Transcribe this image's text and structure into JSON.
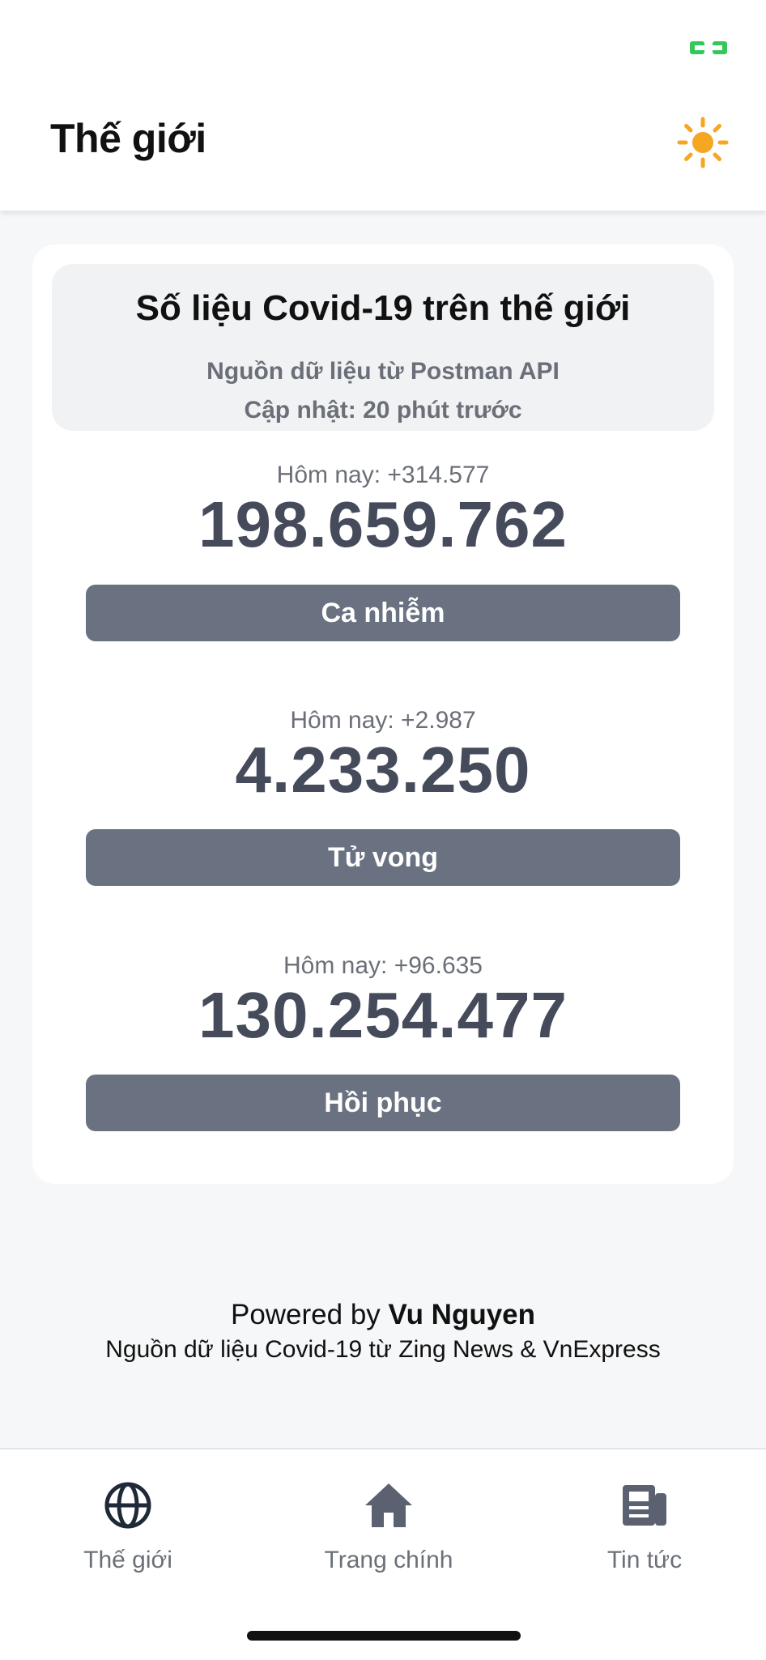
{
  "colors": {
    "accent_sun": "#f5a623",
    "stat_value": "#454b5a",
    "stat_button": "#6a7180",
    "status_green": "#34c759"
  },
  "header": {
    "title": "Thế giới",
    "theme_icon": "sun-icon"
  },
  "summary": {
    "title": "Số liệu Covid-19 trên thế giới",
    "source": "Nguồn dữ liệu từ Postman API",
    "updated": "Cập nhật: 20 phút trước"
  },
  "stats": [
    {
      "today": "Hôm nay: +314.577",
      "value": "198.659.762",
      "label": "Ca nhiễm"
    },
    {
      "today": "Hôm nay: +2.987",
      "value": "4.233.250",
      "label": "Tử vong"
    },
    {
      "today": "Hôm nay: +96.635",
      "value": "130.254.477",
      "label": "Hồi phục"
    }
  ],
  "footer": {
    "powered_prefix": "Powered by",
    "powered_name": "Vu Nguyen",
    "source": "Nguồn dữ liệu Covid-19 từ Zing News & VnExpress"
  },
  "tabs": [
    {
      "label": "Thế giới",
      "icon": "globe-icon"
    },
    {
      "label": "Trang chính",
      "icon": "home-icon"
    },
    {
      "label": "Tin tức",
      "icon": "newspaper-icon"
    }
  ]
}
